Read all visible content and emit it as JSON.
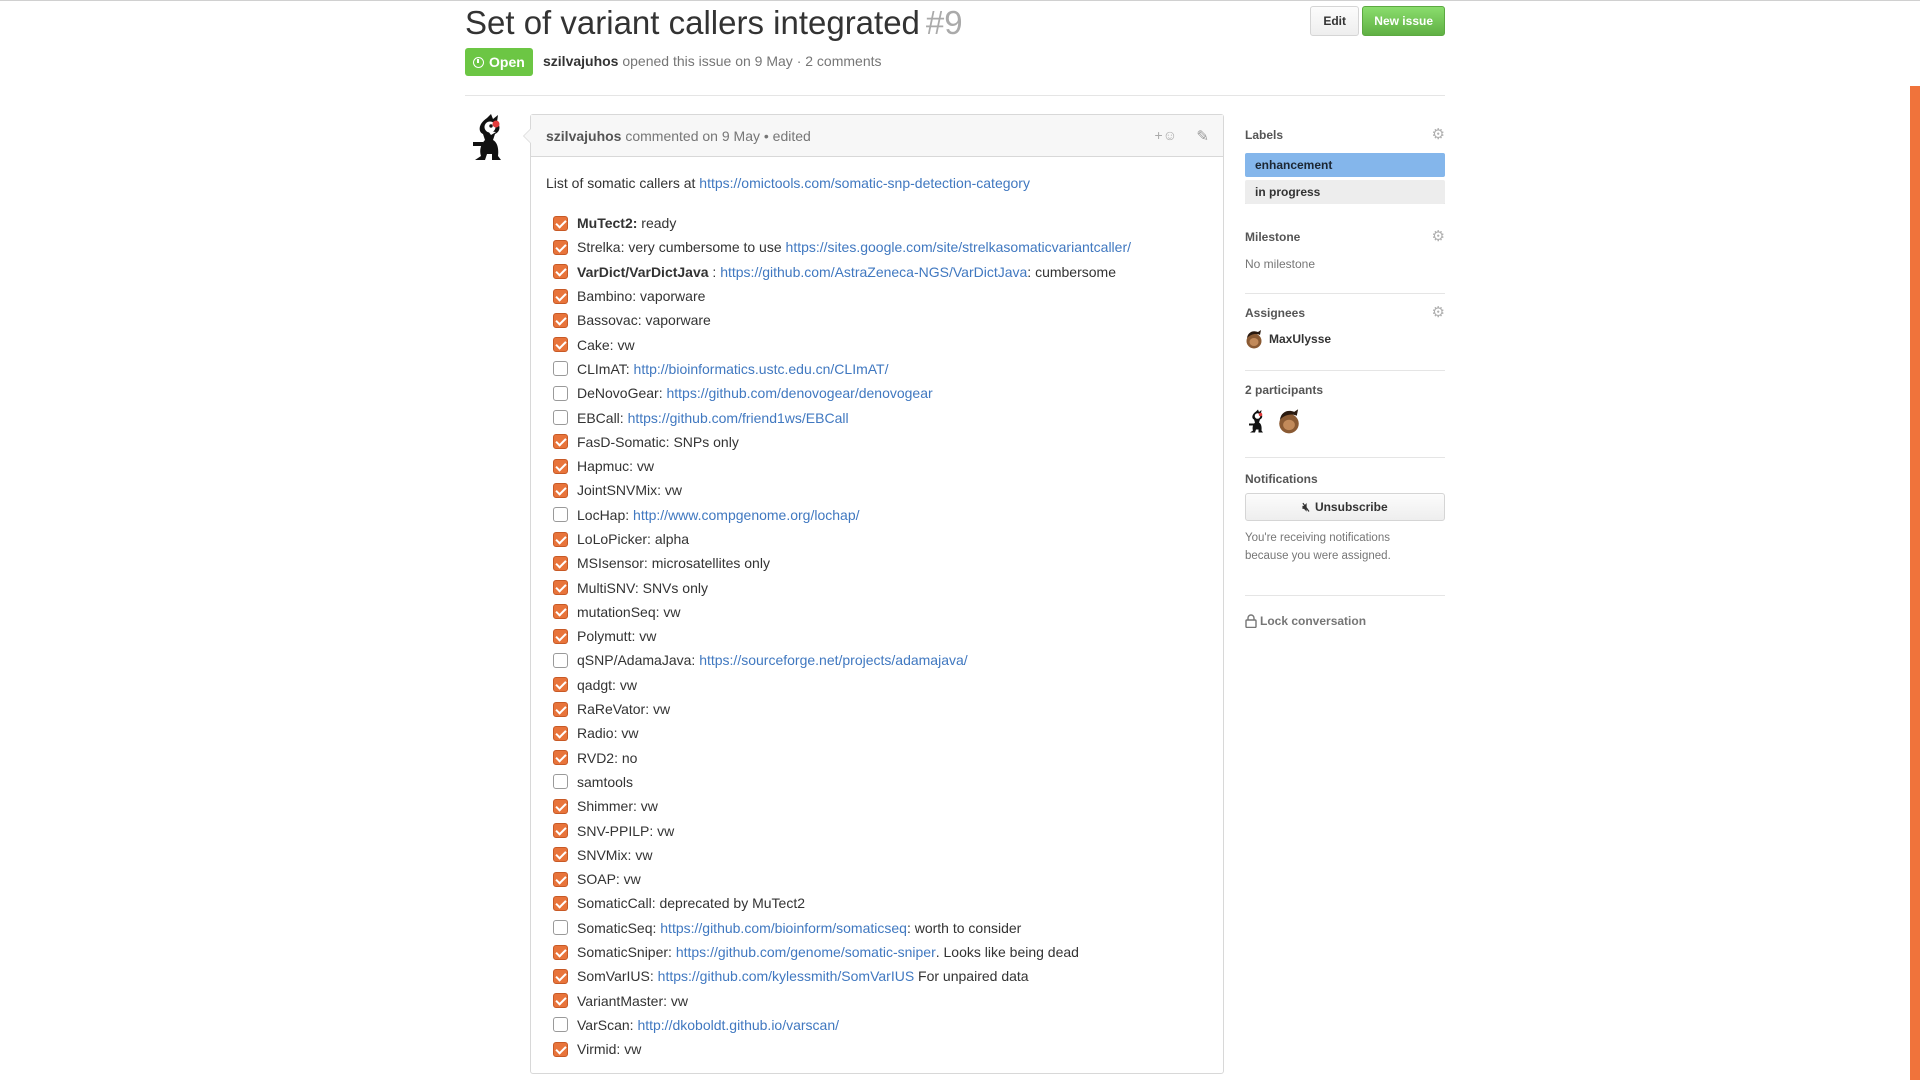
{
  "issue": {
    "title": "Set of variant callers integrated",
    "number": "#9",
    "state": "Open",
    "author": "szilvajuhos",
    "opened_text": "opened this issue on 9 May · 2 comments",
    "edit_label": "Edit",
    "new_issue_label": "New issue"
  },
  "comment": {
    "author": "szilvajuhos",
    "meta": "commented on 9 May • edited",
    "intro_text": "List of somatic callers at",
    "intro_link": "https://omictools.com/somatic-snp-detection-category",
    "reaction_label": "+☺",
    "tasks": [
      {
        "checked": true,
        "name": "MuTect2:",
        "bold": true,
        "link": "",
        "after": " ready"
      },
      {
        "checked": true,
        "name": "Strelka: very cumbersome to use",
        "bold": false,
        "link": "https://sites.google.com/site/strelkasomaticvariantcaller/",
        "after": ""
      },
      {
        "checked": true,
        "name": "VarDict/VarDictJava",
        "bold": true,
        "sep": " : ",
        "link": "https://github.com/AstraZeneca-NGS/VarDictJava",
        "after": ": cumbersome"
      },
      {
        "checked": true,
        "name": "Bambino: vaporware",
        "bold": false,
        "link": "",
        "after": ""
      },
      {
        "checked": true,
        "name": "Bassovac: vaporware",
        "bold": false,
        "link": "",
        "after": ""
      },
      {
        "checked": true,
        "name": "Cake: vw",
        "bold": false,
        "link": "",
        "after": ""
      },
      {
        "checked": false,
        "name": "CLImAT:",
        "bold": false,
        "link": "http://bioinformatics.ustc.edu.cn/CLImAT/",
        "after": ""
      },
      {
        "checked": false,
        "name": "DeNovoGear:",
        "bold": false,
        "link": "https://github.com/denovogear/denovogear",
        "after": ""
      },
      {
        "checked": false,
        "name": "EBCall:",
        "bold": false,
        "link": "https://github.com/friend1ws/EBCall",
        "after": ""
      },
      {
        "checked": true,
        "name": "FasD-Somatic: SNPs only",
        "bold": false,
        "link": "",
        "after": ""
      },
      {
        "checked": true,
        "name": "Hapmuc: vw",
        "bold": false,
        "link": "",
        "after": ""
      },
      {
        "checked": true,
        "name": "JointSNVMix: vw",
        "bold": false,
        "link": "",
        "after": ""
      },
      {
        "checked": false,
        "name": "LocHap:",
        "bold": false,
        "link": "http://www.compgenome.org/lochap/",
        "after": ""
      },
      {
        "checked": true,
        "name": "LoLoPicker: alpha",
        "bold": false,
        "link": "",
        "after": ""
      },
      {
        "checked": true,
        "name": "MSIsensor: microsatellites only",
        "bold": false,
        "link": "",
        "after": ""
      },
      {
        "checked": true,
        "name": "MultiSNV: SNVs only",
        "bold": false,
        "link": "",
        "after": ""
      },
      {
        "checked": true,
        "name": "mutationSeq: vw",
        "bold": false,
        "link": "",
        "after": ""
      },
      {
        "checked": true,
        "name": "Polymutt: vw",
        "bold": false,
        "link": "",
        "after": ""
      },
      {
        "checked": false,
        "name": "qSNP/AdamaJava:",
        "bold": false,
        "link": "https://sourceforge.net/projects/adamajava/",
        "after": ""
      },
      {
        "checked": true,
        "name": "qadgt: vw",
        "bold": false,
        "link": "",
        "after": ""
      },
      {
        "checked": true,
        "name": "RaReVator: vw",
        "bold": false,
        "link": "",
        "after": ""
      },
      {
        "checked": true,
        "name": "Radio: vw",
        "bold": false,
        "link": "",
        "after": ""
      },
      {
        "checked": true,
        "name": "RVD2: no",
        "bold": false,
        "link": "",
        "after": ""
      },
      {
        "checked": false,
        "name": "samtools",
        "bold": false,
        "link": "",
        "after": ""
      },
      {
        "checked": true,
        "name": "Shimmer: vw",
        "bold": false,
        "link": "",
        "after": ""
      },
      {
        "checked": true,
        "name": "SNV-PPILP: vw",
        "bold": false,
        "link": "",
        "after": ""
      },
      {
        "checked": true,
        "name": "SNVMix: vw",
        "bold": false,
        "link": "",
        "after": ""
      },
      {
        "checked": true,
        "name": "SOAP: vw",
        "bold": false,
        "link": "",
        "after": ""
      },
      {
        "checked": true,
        "name": "SomaticCall: deprecated by MuTect2",
        "bold": false,
        "link": "",
        "after": ""
      },
      {
        "checked": false,
        "name": "SomaticSeq:",
        "bold": false,
        "link": "https://github.com/bioinform/somaticseq",
        "after": ": worth to consider"
      },
      {
        "checked": true,
        "name": "SomaticSniper:",
        "bold": false,
        "link": "https://github.com/genome/somatic-sniper",
        "after": ". Looks like being dead"
      },
      {
        "checked": true,
        "name": "SomVarIUS:",
        "bold": false,
        "link": "https://github.com/kylessmith/SomVarIUS",
        "after": " For unpaired data"
      },
      {
        "checked": true,
        "name": "VariantMaster: vw",
        "bold": false,
        "link": "",
        "after": ""
      },
      {
        "checked": false,
        "name": "VarScan:",
        "bold": false,
        "link": "http://dkoboldt.github.io/varscan/",
        "after": ""
      },
      {
        "checked": true,
        "name": "Virmid: vw",
        "bold": false,
        "link": "",
        "after": ""
      }
    ]
  },
  "sidebar": {
    "labels_title": "Labels",
    "labels": [
      {
        "text": "enhancement",
        "bg": "#84b6eb",
        "fg": "#1c2733"
      },
      {
        "text": "in progress",
        "bg": "#ededed",
        "fg": "#333333"
      }
    ],
    "milestone_title": "Milestone",
    "milestone_value": "No milestone",
    "assignees_title": "Assignees",
    "assignee_name": "MaxUlysse",
    "participants_title": "2 participants",
    "notifications_title": "Notifications",
    "unsubscribe_label": "Unsubscribe",
    "notification_reason": "You're receiving notifications because you were assigned.",
    "lock_label": "Lock conversation"
  },
  "colors": {
    "accent_link": "#4078c0",
    "open_green": "#6cc644",
    "checkbox_orange": "#e8743b",
    "scrollbar": "#f0733b"
  }
}
